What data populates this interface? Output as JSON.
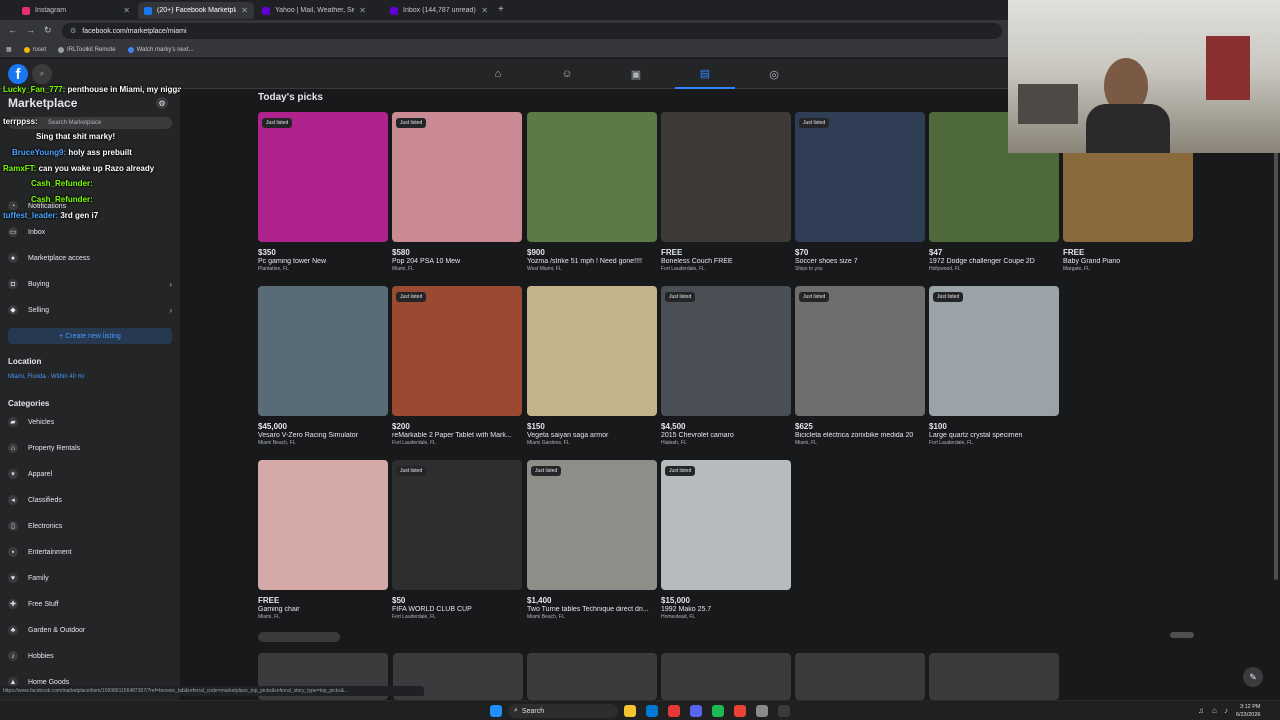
{
  "browser": {
    "tabs": [
      {
        "title": "Instagram",
        "color": "#e1306c"
      },
      {
        "title": "(20+) Facebook Marketplace | F",
        "color": "#1877f2"
      },
      {
        "title": "Yahoo | Mail, Weather, Search",
        "color": "#6001d2"
      },
      {
        "title": "Inbox (144,787 unread) - moraz",
        "color": "#6001d2"
      }
    ],
    "url": "facebook.com/marketplace/miami",
    "bookmarks": [
      "roset",
      "IRLToolkit Remote",
      "Watch marky's next..."
    ]
  },
  "header": {
    "logo": "f",
    "nav_icons": [
      "home-icon",
      "friends-icon",
      "video-icon",
      "marketplace-icon",
      "groups-icon"
    ]
  },
  "sidebar": {
    "title": "Marketplace",
    "search_placeholder": "Search Marketplace",
    "items": [
      {
        "label": "Notifications",
        "icon": "bell-icon"
      },
      {
        "label": "Inbox",
        "icon": "inbox-icon"
      },
      {
        "label": "Marketplace access",
        "icon": "access-icon"
      },
      {
        "label": "Buying",
        "icon": "bag-icon"
      },
      {
        "label": "Selling",
        "icon": "tag-icon"
      }
    ],
    "create_label": "+ Create new listing",
    "location_heading": "Location",
    "location_value": "Miami, Florida · Within 40 mi",
    "categories_heading": "Categories",
    "categories": [
      "Vehicles",
      "Property Rentals",
      "Apparel",
      "Classifieds",
      "Electronics",
      "Entertainment",
      "Family",
      "Free Stuff",
      "Garden & Outdoor",
      "Hobbies",
      "Home Goods"
    ]
  },
  "chat": [
    {
      "user": "Lucky_Fan_777:",
      "text": "penthouse in Miami, my nigga",
      "color": "green"
    },
    {
      "user": "terrppss:",
      "text": "",
      "color": "white"
    },
    {
      "user": "",
      "text": "Sing that shit marky!",
      "color": "red"
    },
    {
      "user": "BruceYoung9:",
      "text": "holy ass prebuilt",
      "color": "blue"
    },
    {
      "user": "RamxFT:",
      "text": "can you wake up Razo already",
      "color": "green"
    },
    {
      "user": "Cash_Refunder:",
      "text": "",
      "color": "green"
    },
    {
      "user": "Cash_Refunder:",
      "text": "",
      "color": "green"
    },
    {
      "user": "tuffest_leader:",
      "text": "3rd gen i7",
      "color": "blue"
    }
  ],
  "main": {
    "section_title": "Today's picks",
    "listings": [
      {
        "price": "$350",
        "title": "Pc gaming tower New",
        "location": "Plantation, FL",
        "badge": "Just listed",
        "color": "#b0238e"
      },
      {
        "price": "$580",
        "title": "Pop 204 PSA 10 Mew",
        "location": "Miami, FL",
        "badge": "Just listed",
        "color": "#c98a94"
      },
      {
        "price": "$900",
        "title": "Yozma /strike 51 mph ! Need gone!!!!",
        "location": "West Miami, FL",
        "badge": "",
        "color": "#5c7a45"
      },
      {
        "price": "FREE",
        "title": "Boneless Couch FREE",
        "location": "Fort Lauderdale, FL",
        "badge": "",
        "color": "#3d3a38"
      },
      {
        "price": "$70",
        "title": "Soccer shoes size 7",
        "location": "Ships to you",
        "badge": "Just listed",
        "color": "#2f3e55"
      },
      {
        "price": "$47",
        "title": "1972 Dodge challenger Coupe 2D",
        "location": "Hollywood, FL",
        "badge": "",
        "color": "#4e6a3a"
      },
      {
        "price": "FREE",
        "title": "Baby Grand Piano",
        "location": "Margate, FL",
        "badge": "",
        "color": "#8a6a3c"
      },
      {
        "price": "$45,000",
        "title": "Vesaro V-Zero Racing Simulator",
        "location": "Miami Beach, FL",
        "badge": "",
        "color": "#5a6b78"
      },
      {
        "price": "$200",
        "title": "reMarkable 2 Paper Tablet with Mark...",
        "location": "Fort Lauderdale, FL",
        "badge": "Just listed",
        "color": "#9a4a30"
      },
      {
        "price": "$150",
        "title": "Vegeta saiyan saga armor",
        "location": "Miami Gardens, FL",
        "badge": "",
        "color": "#c4b48a"
      },
      {
        "price": "$4,500",
        "title": "2015 Chevrolet camaro",
        "location": "Hialeah, FL",
        "badge": "Just listed",
        "color": "#4a4f55"
      },
      {
        "price": "$625",
        "title": "Bicicleta eléctrica zorixbike medida 20",
        "location": "Miami, FL",
        "badge": "Just listed",
        "color": "#6e6e6e"
      },
      {
        "price": "$100",
        "title": "Large quartz crystal specimen",
        "location": "Fort Lauderdale, FL",
        "badge": "Just listed",
        "color": "#9aa3a8"
      },
      {
        "price": "FREE",
        "title": "Gaming chair",
        "location": "Miami, FL",
        "badge": "",
        "color": "#d4a9a8"
      },
      {
        "price": "$50",
        "title": "FIFA WORLD CLUB CUP",
        "location": "Fort Lauderdale, FL",
        "badge": "Just listed",
        "color": "#2e2e30"
      },
      {
        "price": "$1,400",
        "title": "Two Turne tables Technique direct dri...",
        "location": "Miami Beach, FL",
        "badge": "Just listed",
        "color": "#8f8d88"
      },
      {
        "price": "$15,000",
        "title": "1992 Mako 25.7",
        "location": "Homestead, FL",
        "badge": "Just listed",
        "color": "#b8bbbd"
      }
    ]
  },
  "status_url": "https://www.facebook.com/marketplace/item/10938611564873​57/?ref=browse_tab&referral_code=marketplace_top_picks&referral_story_type=top_picks&...",
  "taskbar": {
    "search_label": "Search",
    "time": "3:12 PM",
    "date": "6/23/2026"
  }
}
